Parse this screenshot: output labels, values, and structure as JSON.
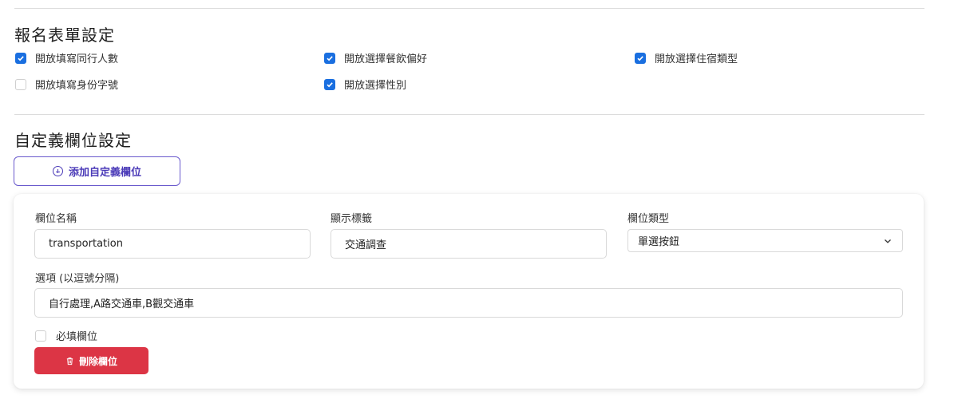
{
  "registration_form": {
    "title": "報名表單設定",
    "options": [
      {
        "label": "開放填寫同行人數",
        "checked": true
      },
      {
        "label": "開放選擇餐飲偏好",
        "checked": true
      },
      {
        "label": "開放選擇住宿類型",
        "checked": true
      },
      {
        "label": "開放填寫身份字號",
        "checked": false
      },
      {
        "label": "開放選擇性別",
        "checked": true
      }
    ]
  },
  "custom_fields": {
    "title": "自定義欄位設定",
    "add_button_label": "添加自定義欄位",
    "field": {
      "name_label": "欄位名稱",
      "name_value": "transportation",
      "display_label": "顯示標籤",
      "display_value": "交通調查",
      "type_label": "欄位類型",
      "type_value": "單選按鈕",
      "options_label": "選項 (以逗號分隔)",
      "options_value": "自行處理,A路交通車,B觀交通車",
      "required_label": "必填欄位",
      "required_checked": false,
      "delete_button_label": "刪除欄位"
    }
  },
  "colors": {
    "accent": "#1a6fe0",
    "add_button": "#4b3bb8",
    "danger": "#dc3545"
  }
}
